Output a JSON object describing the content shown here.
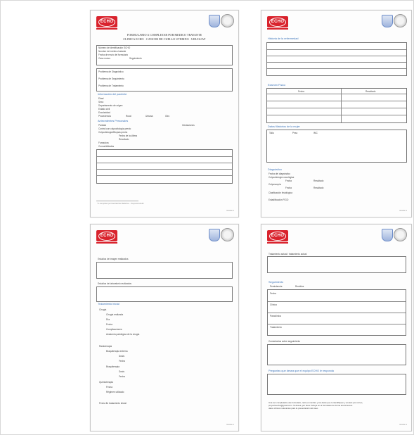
{
  "logo_text": "ECHO",
  "page1": {
    "title_line1": "FORMULARIO A COMPLETAR POR MEDICO TRATANTE",
    "title_line2": "CLINICA ECHO · CANCER DE CUELLO UTERINO · URUGUAY",
    "id_fields": [
      "Número de identificación ECHO",
      "Nombre del médico tratante",
      "Fecha de envío del formulario",
      "Caso nuevo",
      "Seguimiento"
    ],
    "problems": [
      "Problema de Diagnóstico",
      "Problema de Seguimiento",
      "Problema de Tratamiento"
    ],
    "section_patient": "Información del paciente",
    "patient_fields": [
      "Edad",
      "Sexo",
      "Departamento de origen",
      "Estado civil",
      "Escolaridad",
      "Procedencia",
      "Rural",
      "Urbana",
      "Otro"
    ],
    "section_personal": "Antecedentes Personales",
    "personal_fields": [
      "Paridad",
      "Gestaciones",
      "Control con colpocitología previo",
      "Colpocitología/Biopsia previa",
      "Fecha de la última",
      "Resultado",
      "Fumadora",
      "Comorbilidades"
    ],
    "footnote": "* A completar por Facultad de Medicina – Proyecto ECHO",
    "version": "Versión 1"
  },
  "page2": {
    "section_history": "Historia de la enfermedad",
    "section_exam": "Examen Físico",
    "exam_cols": [
      "Fecha",
      "Resultado"
    ],
    "section_recent": "Datos filiatorios de la mujer",
    "recent_fields": [
      "Talla",
      "Peso",
      "IMC"
    ],
    "section_diag": "Diagnóstico",
    "diag_fields": [
      "Fecha del diagnóstico",
      "Colpocitología oncológica",
      "Fecha",
      "Resultado",
      "Colposcopía",
      "Fecha",
      "Resultado",
      "Clasificación histológica",
      "Estadificación FIGO"
    ],
    "version": "Versión 1"
  },
  "page3": {
    "image_studies": "Estudios de imagen realizados",
    "lab_studies": "Estudios de laboratorio realizados",
    "section_treat": "Tratamiento inicial",
    "treat_fields": [
      "Cirugía",
      "Cirugía realizada",
      "Día",
      "Fecha",
      "Complicaciones",
      "Anatomía patológica de la cirugía",
      "Radioterapia",
      "Braquiterapia externa",
      "Dosis",
      "Fecha",
      "Braquiterapia",
      "Dosis",
      "Fecha",
      "Quimioterapia",
      "Fecha",
      "Régimen utilizado"
    ],
    "end_treat": "Fecha fin tratamiento inicial",
    "version": "Versión 1"
  },
  "page4": {
    "current_treat": "Tratamiento actual / tratamiento actual",
    "section_follow": "Seguimiento",
    "follow_header": [
      "Persistencia",
      "Recidiva"
    ],
    "follow_rows": [
      "Fecha",
      "Clínica",
      "Paraclínica",
      "Tratamiento"
    ],
    "comments": "Comentarios sobre seguimiento",
    "section_question": "Preguntas que desea que el equipo ECHO le responda",
    "note_line1": "Una vez completado este formulario, retire el nombre y los datos que lo identifiquen y envíelo por correo,",
    "note_line2": "proyectoecho@gmail.com. Si desea, por favor incluya en el formulario de forma anónima sus",
    "note_line3": "datos clínicos relevantes para la presentación del caso.",
    "version": "Versión 1"
  }
}
